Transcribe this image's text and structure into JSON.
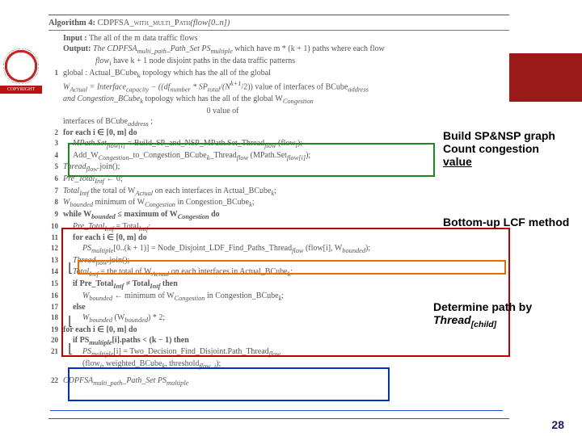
{
  "crest_copyright": "COPYRIGHT",
  "pagenum": "28",
  "algo_title_prefix": "Algorithm 4: ",
  "algo_title_name": "CDPFSA_with_multi_Path",
  "algo_title_args": "(flow[0..n])",
  "input_label": "Input   :",
  "input_text": "The all of the m data traffic flows",
  "output_label": "Output:",
  "output_text_a": "The CDPFSA",
  "output_sub_a": "multi_path",
  "output_text_b": "_Path_Set PS",
  "output_sub_b": "multiple",
  "output_text_c": " which have m * (k + 1) paths where each flow",
  "output_sub_c": "i",
  "output_text_d": " have k + 1 node disjoint paths in the data traffic patterns",
  "l1a": "global : Actual_BCube",
  "l1sub": "k",
  "l1b": " topology which has the all of the global",
  "l1c": "W",
  "l1csub": "Actual",
  "l1d": " = Interface",
  "l1dsub": "capacity",
  "l1e": " − ((df",
  "l1esub": "number",
  "l1f": " * SP",
  "l1fsub": "total",
  "l1g": "/(N",
  "l1h": "k+1",
  "l1i": "/2)) value of interfaces of BCube",
  "l1isub": "address",
  "l1j": "and Congestion_BCube",
  "l1k": " topology which has the all of the global W",
  "l1ksub": "Congestion",
  "l1l": "                                                                       0 value of",
  "l1m": "interfaces of BCube",
  "l1msub": "address",
  "l1n": " ;",
  "l2": "for each i ∈ [0, m] do",
  "l3a": "MPath.Set",
  "l3sub": "flow[i]",
  "l3b": " = Build_SP_and_NSP_MPath.Set_Thread",
  "l3bsub": "flow",
  "l3c": " (flow",
  "l3csub": "i",
  "l3d": ");",
  "l4a": "Add_W",
  "l4sub": "Congestion",
  "l4b": "_to_Congestion_BCube",
  "l4bsub": "k",
  "l4c": "_Thread",
  "l4csub": "flow",
  "l4d": " (MPath.Set",
  "l4dsub": "flow[i]",
  "l4e": ");",
  "l5": "Thread",
  "l5sub": "flow",
  "l5b": ".join();",
  "l6": "Pre_Total",
  "l6sub": "Intf",
  "l6b": " ← 0;",
  "l7": "Total",
  "l7sub": "Intf",
  "l7b": "    the total of W",
  "l7bsub": "Actual",
  "l7c": " on each interfaces in Actual_BCube",
  "l7csub": "k",
  "l7d": ";",
  "l8": "W",
  "l8sub": "bounded",
  "l8b": "    minimum of W",
  "l8bsub": "Congestion",
  "l8c": " in Congestion_BCube",
  "l8csub": "k",
  "l8d": ";",
  "l9a": "while W",
  "l9sub": "bounded",
  "l9b": " ≤ maximum of W",
  "l9bsub": "Congestion",
  "l9c": " do",
  "l10": "Pre_Total",
  "l10sub": "Intf",
  "l10b": " = Total",
  "l10bsub": "Intf",
  "l10c": ";",
  "l11": "for each i ∈ [0, m] do",
  "l12a": "PS",
  "l12sub": "multiple",
  "l12b": "[0..(k + 1)] = Node_Disjoint_LDF_Find_Paths_Thread",
  "l12bsub": "flow",
  "l12c": " (flow[i], W",
  "l12csub": "bounded",
  "l12d": ");",
  "l13": "Thread",
  "l13sub": "flow",
  "l13b": ".join();",
  "l14": "Total",
  "l14sub": "Intf",
  "l14b": " = the total of W",
  "l14bsub": "Actual",
  "l14c": " on each interfaces in Actual_BCube",
  "l14csub": "k",
  "l14d": ";",
  "l15a": "if Pre_Total",
  "l15sub": "Intf",
  "l15b": " ≠ Total",
  "l15bsub": "Intf",
  "l15c": " then",
  "l16": "W",
  "l16sub": "bounded",
  "l16b": " ← minimum of W",
  "l16bsub": "Congestion",
  "l16c": " in Congestion_BCube",
  "l16csub": "k",
  "l16d": ";",
  "l17": "else",
  "l18": "W",
  "l18sub": "bounded",
  "l18b": "    (W",
  "l18bsub": "bounded",
  "l18c": ") * 2;",
  "l19": "for each i ∈ [0, m] do",
  "l20a": "if PS",
  "l20sub": "multiple",
  "l20b": "[i].paths < (k − 1) then",
  "l21a": "PS",
  "l21sub": "multiple",
  "l21b": "[i] = Two_Decision_Find_Disjoint.Path_Thread",
  "l21bsub": "flow",
  "l21c": "(flow",
  "l21csub": "i",
  "l21d": ", weighted_BCube",
  "l21dsub": "k",
  "l21e": ", threshold",
  "l21esub": "flow_i",
  "l21f": ");",
  "l22a": "CDPFSA",
  "l22sub": "multi_path",
  "l22b": "_Path_Set PS",
  "l22bsub": "multiple",
  "callout1_l1": "Build SP&NSP graph",
  "callout1_l2": "Count congestion",
  "callout1_l3": "value",
  "callout2": "Bottom-up LCF method",
  "callout3_l1": "Determine path by",
  "callout3_l2a": "Thread",
  "callout3_l2b": "[child]"
}
